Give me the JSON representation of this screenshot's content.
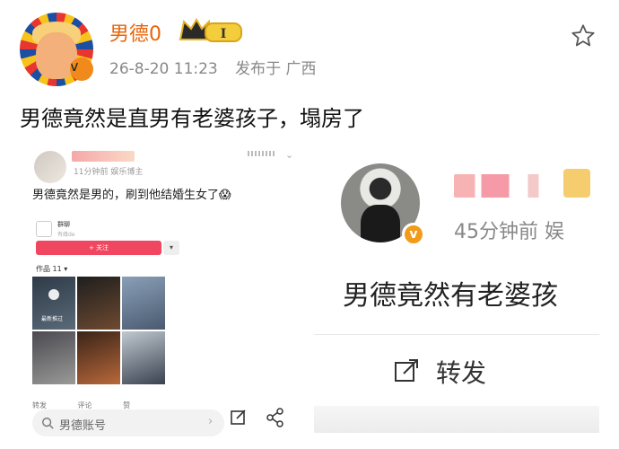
{
  "post": {
    "username": "男德0",
    "level_badge": "I",
    "timestamp": "26-8-20 11:23",
    "location": "发布于 广西",
    "text": "男德竟然是直男有老婆孩子，塌房了"
  },
  "left_screenshot": {
    "meta": "11分钟前 娱乐博主",
    "text": "男德竟然是男的，刷到他结婚生女了😱",
    "card_title": "群聊",
    "card_sub": "有缘de",
    "follow_label": "+ 关注",
    "works_label": "作品 11 ▾",
    "tile_label": "最新推过",
    "bottom_actions": [
      "转发",
      "评论",
      "赞"
    ],
    "search_placeholder": "男德账号",
    "edit_label": "评论",
    "share_label": "分享"
  },
  "right_screenshot": {
    "meta": "45分钟前 娱",
    "text": "男德竟然有老婆孩",
    "repost_label": "转发"
  },
  "colors": {
    "username": "#e8650a",
    "follow": "#f0465f",
    "badge": "#f08a1a"
  }
}
